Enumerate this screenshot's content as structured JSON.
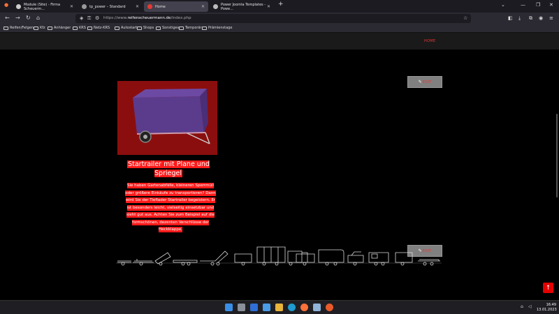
{
  "browser": {
    "tabs": [
      {
        "label": "Module (Site) - Firma Scheuerm...",
        "active": false
      },
      {
        "label": "tp_power – Standard",
        "active": false
      },
      {
        "label": "Home",
        "active": true
      },
      {
        "label": "Power Joomla Templates - Powe...",
        "active": false
      }
    ],
    "new_tab": "+",
    "url_prefix": "https://www.",
    "url_domain": "reifenscheuermann.de",
    "url_path": "/index.php",
    "bookmarks": [
      "Reifen/Felgen",
      "Kfz",
      "Anhänger",
      "KRS",
      "Netz-KRS",
      "Autostart",
      "Shops",
      "Sonstiges",
      "Temporär",
      "Prämienstage"
    ]
  },
  "site": {
    "menu": {
      "home": "HOME"
    },
    "edit_label": "EDIT",
    "product": {
      "title": "Startrailer mit Plane und Spriegel",
      "description_lines": [
        "Sie haben Gartenabfälle, kleineren Sperrmüll",
        "oder größere Einkäufe zu transportieren? Dann",
        "wird Sie der Tieflader Startrailer begeistern. Er",
        "ist besonders leicht, vielseitig einsetzbar und",
        "sieht gut aus. Achten Sie zum Beispiel auf die",
        "formschönen, dezenten Verschlüsse der",
        "Heckklappe."
      ]
    }
  },
  "taskbar": {
    "time": "16:49",
    "date": "13.01.2023"
  },
  "colors": {
    "accent_red": "#ff1a1a",
    "product_bg": "#8b0e0e",
    "edit_bg": "#808080"
  }
}
